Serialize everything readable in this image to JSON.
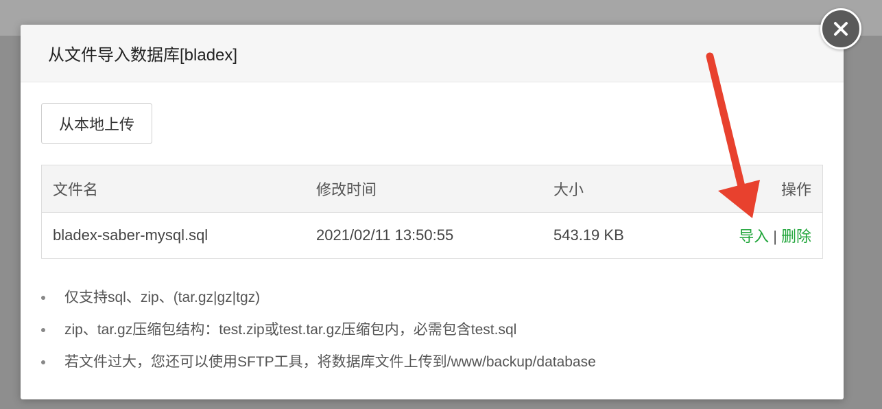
{
  "dialog": {
    "title": "从文件导入数据库[bladex]",
    "upload_button": "从本地上传"
  },
  "table": {
    "headers": {
      "name": "文件名",
      "mtime": "修改时间",
      "size": "大小",
      "ops": "操作"
    },
    "rows": [
      {
        "name": "bladex-saber-mysql.sql",
        "mtime": "2021/02/11 13:50:55",
        "size": "543.19 KB",
        "import_label": "导入",
        "separator": "|",
        "delete_label": "删除"
      }
    ]
  },
  "notes": [
    "仅支持sql、zip、(tar.gz|gz|tgz)",
    "zip、tar.gz压缩包结构：test.zip或test.tar.gz压缩包内，必需包含test.sql",
    "若文件过大，您还可以使用SFTP工具，将数据库文件上传到/www/backup/database"
  ],
  "colors": {
    "link_green": "#20a53a",
    "annotation_arrow": "#e8412e"
  },
  "icons": {
    "close": "close-icon"
  }
}
